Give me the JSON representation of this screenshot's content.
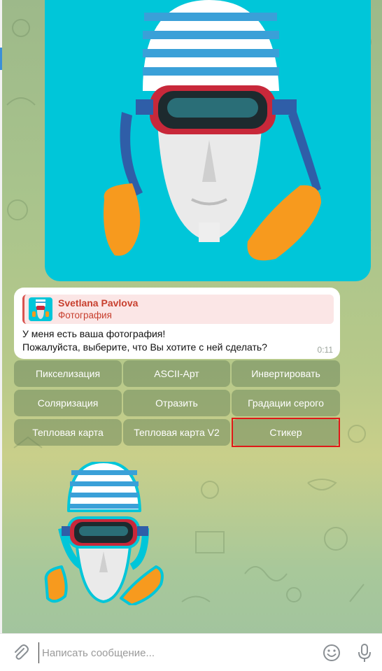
{
  "reply": {
    "name": "Svetlana Pavlova",
    "subtitle": "Фотография"
  },
  "message": {
    "text": "У меня есть ваша фотография!\nПожалуйста, выберите, что Вы хотите с ней сделать?",
    "time": "0:11"
  },
  "keyboard": {
    "row1": [
      "Пикселизация",
      "ASCII-Арт",
      "Инвертировать"
    ],
    "row2": [
      "Соляризация",
      "Отразить",
      "Градации серого"
    ],
    "row3": [
      "Тепловая карта",
      "Тепловая карта V2",
      "Стикер"
    ]
  },
  "composer": {
    "placeholder": "Написать сообщение..."
  },
  "colors": {
    "photo_bg": "#00c6d9",
    "reply_accent": "#c8402f",
    "highlight": "#e01818"
  },
  "icons": [
    "attach-icon",
    "emoji-icon",
    "microphone-icon"
  ]
}
